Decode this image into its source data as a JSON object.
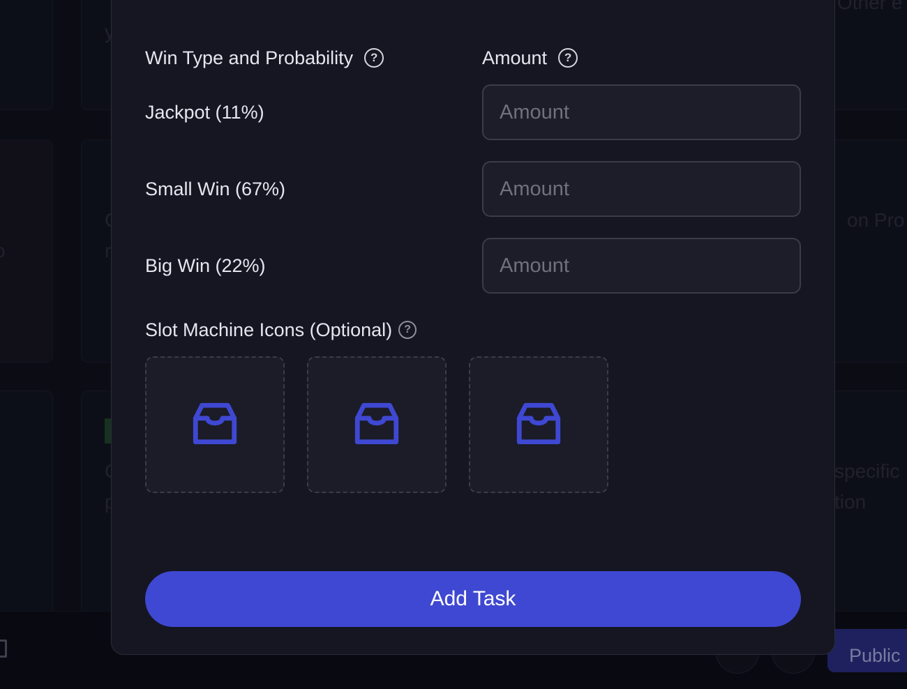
{
  "background": {
    "fragments": [
      "Other e",
      "y",
      "on Pro",
      "specific",
      "tion",
      "C",
      "r",
      "o",
      "C",
      "p"
    ]
  },
  "modal": {
    "header": {
      "win_type_label": "Win Type and Probability",
      "amount_label": "Amount"
    },
    "rows": [
      {
        "label": "Jackpot (11%)",
        "placeholder": "Amount",
        "value": ""
      },
      {
        "label": "Small Win (67%)",
        "placeholder": "Amount",
        "value": ""
      },
      {
        "label": "Big Win (22%)",
        "placeholder": "Amount",
        "value": ""
      }
    ],
    "icons_section": {
      "label": "Slot Machine Icons (Optional)",
      "uploads": [
        {
          "icon": "inbox-icon"
        },
        {
          "icon": "inbox-icon"
        },
        {
          "icon": "inbox-icon"
        }
      ]
    },
    "submit_label": "Add Task"
  },
  "footer": {
    "public_label": "Public"
  },
  "colors": {
    "accent": "#3f48d2",
    "icon": "#3f48d2",
    "modal_bg": "#151622",
    "page_bg": "#0f1019"
  }
}
